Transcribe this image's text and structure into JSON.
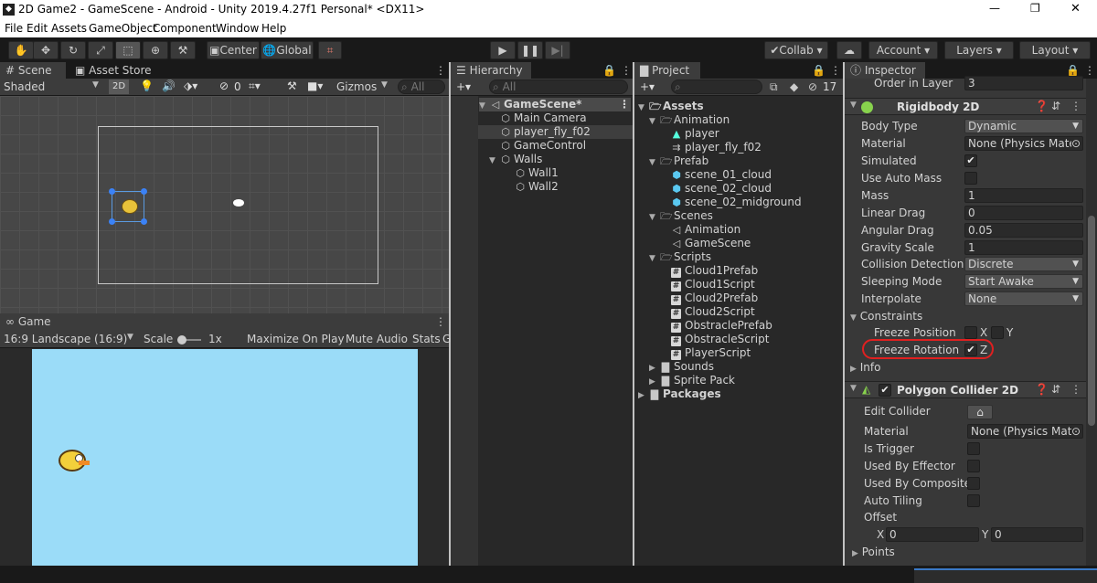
{
  "window": {
    "title": "2D Game2 - GameScene - Android - Unity 2019.4.27f1 Personal* <DX11>",
    "min": "—",
    "max": "❐",
    "close": "✕",
    "logo": "unity-logo-icon"
  },
  "menu": [
    "File",
    "Edit",
    "Assets",
    "GameObject",
    "Component",
    "Window",
    "Help"
  ],
  "toolbar": {
    "center": "Center",
    "global": "Global",
    "collab": "Collab",
    "account": "Account",
    "layers": "Layers",
    "layout": "Layout"
  },
  "scene": {
    "tab_scene": "Scene",
    "tab_store": "Asset Store",
    "shading": "Shaded",
    "mode2d": "2D",
    "hidden_count": "0",
    "gizmos": "Gizmos",
    "search_placeholder": "All"
  },
  "game": {
    "tab": "Game",
    "aspect": "16:9 Landscape (16:9)",
    "scale_label": "Scale",
    "scale_value": "1x",
    "maximize": "Maximize On Play",
    "mute": "Mute Audio",
    "stats": "Stats",
    "bg_color": "#9bdcf8"
  },
  "hierarchy": {
    "tab": "Hierarchy",
    "search_placeholder": "All",
    "scene": "GameScene*",
    "items": [
      "Main Camera",
      "player_fly_f02",
      "GameControl",
      "Walls",
      "Wall1",
      "Wall2"
    ]
  },
  "project": {
    "tab": "Project",
    "count": "17",
    "root": "Assets",
    "items": [
      "Animation",
      "player",
      "player_fly_f02",
      "Prefab",
      "scene_01_cloud",
      "scene_02_cloud",
      "scene_02_midground",
      "Scenes",
      "Animation",
      "GameScene",
      "Scripts",
      "Cloud1Prefab",
      "Cloud1Script",
      "Cloud2Prefab",
      "Cloud2Script",
      "ObstraclePrefab",
      "ObstracleScript",
      "PlayerScript",
      "Sounds",
      "Sprite Pack",
      "Packages"
    ]
  },
  "inspector": {
    "tab": "Inspector",
    "order_label": "Order in Layer",
    "order_value": "3",
    "rb_title": "Rigidbody 2D",
    "rb_fields": [
      [
        "Body Type",
        "Dynamic"
      ],
      [
        "Material",
        "None (Physics Mate"
      ],
      [
        "Simulated",
        ""
      ],
      [
        "Use Auto Mass",
        ""
      ],
      [
        "Mass",
        "1"
      ],
      [
        "Linear Drag",
        "0"
      ],
      [
        "Angular Drag",
        "0.05"
      ],
      [
        "Gravity Scale",
        "1"
      ],
      [
        "Collision Detection",
        "Discrete"
      ],
      [
        "Sleeping Mode",
        "Start Awake"
      ],
      [
        "Interpolate",
        "None"
      ]
    ],
    "constraints": "Constraints",
    "freeze_pos": "Freeze Position",
    "freeze_rot": "Freeze Rotation",
    "x": "X",
    "y": "Y",
    "z": "Z",
    "info": "Info",
    "pc_title": "Polygon Collider 2D",
    "pc_fields": [
      "Edit Collider",
      "Material",
      "Is Trigger",
      "Used By Effector",
      "Used By Composite",
      "Auto Tiling",
      "Offset"
    ],
    "pc_material": "None (Physics Mate",
    "offset_x": "0",
    "offset_y": "0",
    "points": "Points",
    "highlight_color": "#e02020"
  }
}
